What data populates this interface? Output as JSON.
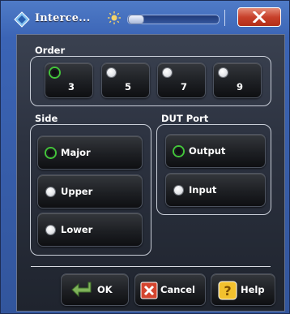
{
  "window": {
    "title": "Interce...",
    "icons": {
      "app": "rohde-schwarz-diamond-icon",
      "brightness": "sun-icon",
      "close": "close-x-icon"
    },
    "transparency_level": 0.05
  },
  "order": {
    "label": "Order",
    "options": [
      {
        "label": "3",
        "selected": true
      },
      {
        "label": "5",
        "selected": false
      },
      {
        "label": "7",
        "selected": false
      },
      {
        "label": "9",
        "selected": false
      }
    ]
  },
  "side": {
    "label": "Side",
    "options": [
      {
        "label": "Major",
        "selected": true
      },
      {
        "label": "Upper",
        "selected": false
      },
      {
        "label": "Lower",
        "selected": false
      }
    ]
  },
  "dut_port": {
    "label": "DUT Port",
    "options": [
      {
        "label": "Output",
        "selected": true
      },
      {
        "label": "Input",
        "selected": false
      }
    ]
  },
  "actions": {
    "ok": "OK",
    "cancel": "Cancel",
    "help": "Help",
    "icons": {
      "ok": "enter-arrow-icon",
      "cancel": "cancel-x-icon",
      "help": "help-question-icon"
    }
  },
  "colors": {
    "radio_checked": "#43c43a",
    "close_button": "#c8412b",
    "ok_icon": "#6aa84f",
    "cancel_icon": "#d4452f",
    "help_icon": "#f2c12e"
  }
}
